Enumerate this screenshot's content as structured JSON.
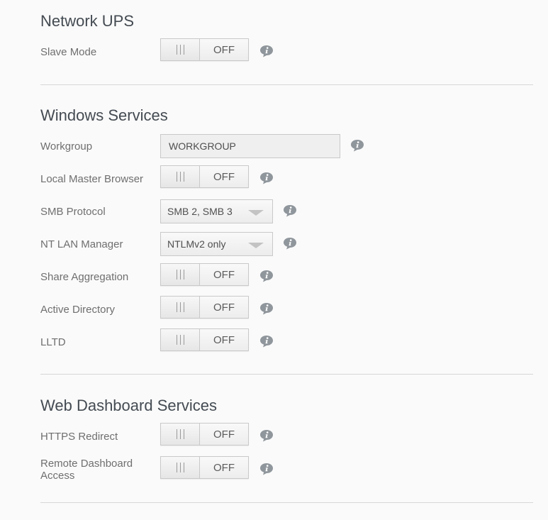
{
  "sections": {
    "network_ups": {
      "title": "Network UPS",
      "slave_mode": {
        "label": "Slave Mode",
        "state": "OFF"
      }
    },
    "windows_services": {
      "title": "Windows Services",
      "workgroup": {
        "label": "Workgroup",
        "value": "WORKGROUP"
      },
      "local_master_browser": {
        "label": "Local Master Browser",
        "state": "OFF"
      },
      "smb_protocol": {
        "label": "SMB Protocol",
        "selected": "SMB 2, SMB 3"
      },
      "nt_lan_manager": {
        "label": "NT LAN Manager",
        "selected": "NTLMv2 only"
      },
      "share_aggregation": {
        "label": "Share Aggregation",
        "state": "OFF"
      },
      "active_directory": {
        "label": "Active Directory",
        "state": "OFF"
      },
      "lltd": {
        "label": "LLTD",
        "state": "OFF"
      }
    },
    "web_dashboard_services": {
      "title": "Web Dashboard Services",
      "https_redirect": {
        "label": "HTTPS Redirect",
        "state": "OFF"
      },
      "remote_dashboard_access": {
        "label_line1": "Remote Dashboard",
        "label_line2": "Access",
        "state": "OFF"
      }
    }
  },
  "icons": {
    "info": "info-speech-bubble-icon",
    "toggle_grip": "grip-lines-icon",
    "dropdown": "caret-down-icon"
  },
  "colors": {
    "background": "#fafafa",
    "title": "#444b52",
    "label": "#6f6f6f",
    "info_icon": "#8f969c",
    "divider": "#d7d7d7"
  }
}
